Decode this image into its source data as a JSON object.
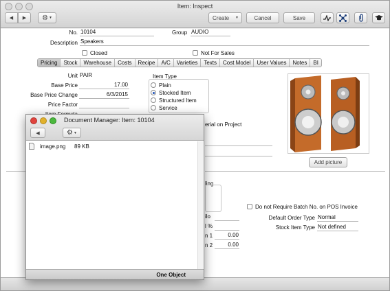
{
  "window": {
    "title": "Item: Inspect",
    "toolbar": {
      "create": "Create",
      "cancel": "Cancel",
      "save": "Save"
    }
  },
  "form": {
    "no_label": "No.",
    "no_value": "10104",
    "group_label": "Group",
    "group_value": "AUDIO",
    "description_label": "Description",
    "description_value": "Speakers",
    "closed_label": "Closed",
    "not_for_sales_label": "Not For Sales"
  },
  "tabs": [
    "Pricing",
    "Stock",
    "Warehouse",
    "Costs",
    "Recipe",
    "A/C",
    "Varieties",
    "Texts",
    "Cost Model",
    "User Values",
    "Notes",
    "BI"
  ],
  "pricing": {
    "unit_label": "Unit",
    "unit_value": "PAIR",
    "base_price_label": "Base Price",
    "base_price_value": "17.00",
    "base_price_change_label": "Base Price Change",
    "base_price_change_value": "6/3/2015",
    "price_factor_label": "Price Factor",
    "price_factor_value": "",
    "item_formula_label": "Item Formula"
  },
  "item_type": {
    "label": "Item Type",
    "options": [
      "Plain",
      "Stocked Item",
      "Structured Item",
      "Service"
    ],
    "selected": "Stocked Item"
  },
  "partial": {
    "material_on_project": "erial on Project",
    "ling": "ling",
    "ilo": "ilo",
    "pct": "l %",
    "n1": "n 1",
    "n1_value": "0.00",
    "n2": "n 2",
    "n2_value": "0.00"
  },
  "right": {
    "add_picture": "Add picture",
    "no_batch_label": "Do not Require Batch No. on POS Invoice",
    "default_order_type_label": "Default Order Type",
    "default_order_type_value": "Normal",
    "stock_item_type_label": "Stock Item Type",
    "stock_item_type_value": "Not defined"
  },
  "doc_manager": {
    "title": "Document Manager: Item: 10104",
    "file_name": "image.png",
    "file_size": "89 KB",
    "footer": "One Object"
  }
}
